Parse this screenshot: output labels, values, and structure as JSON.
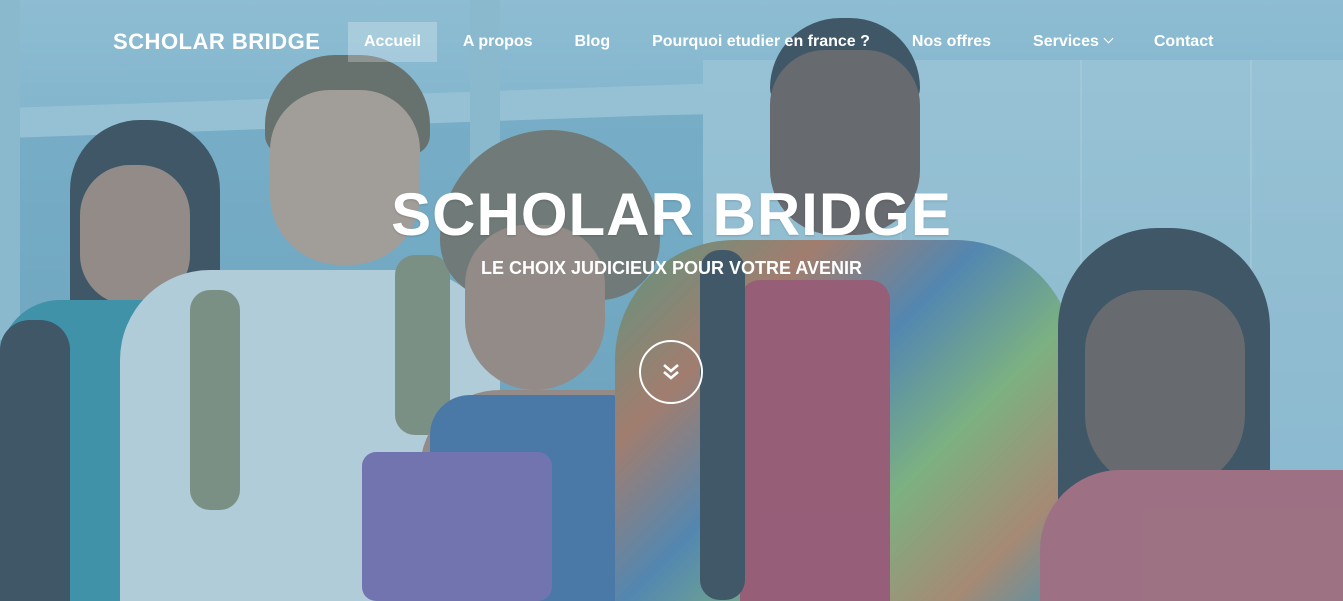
{
  "nav": {
    "brand": "SCHOLAR BRIDGE",
    "items": [
      {
        "label": "Accueil",
        "active": true
      },
      {
        "label": "A propos"
      },
      {
        "label": "Blog"
      },
      {
        "label": "Pourquoi etudier en france ?"
      },
      {
        "label": "Nos offres"
      },
      {
        "label": "Services",
        "dropdown": true
      },
      {
        "label": "Contact"
      }
    ]
  },
  "hero": {
    "title": "SCHOLAR BRIDGE",
    "subtitle": "LE CHOIX JUDICIEUX POUR VOTRE AVENIR",
    "scroll_icon": "double-chevron-down-icon"
  },
  "colors": {
    "overlay": "#60a0be",
    "text": "#ffffff"
  }
}
